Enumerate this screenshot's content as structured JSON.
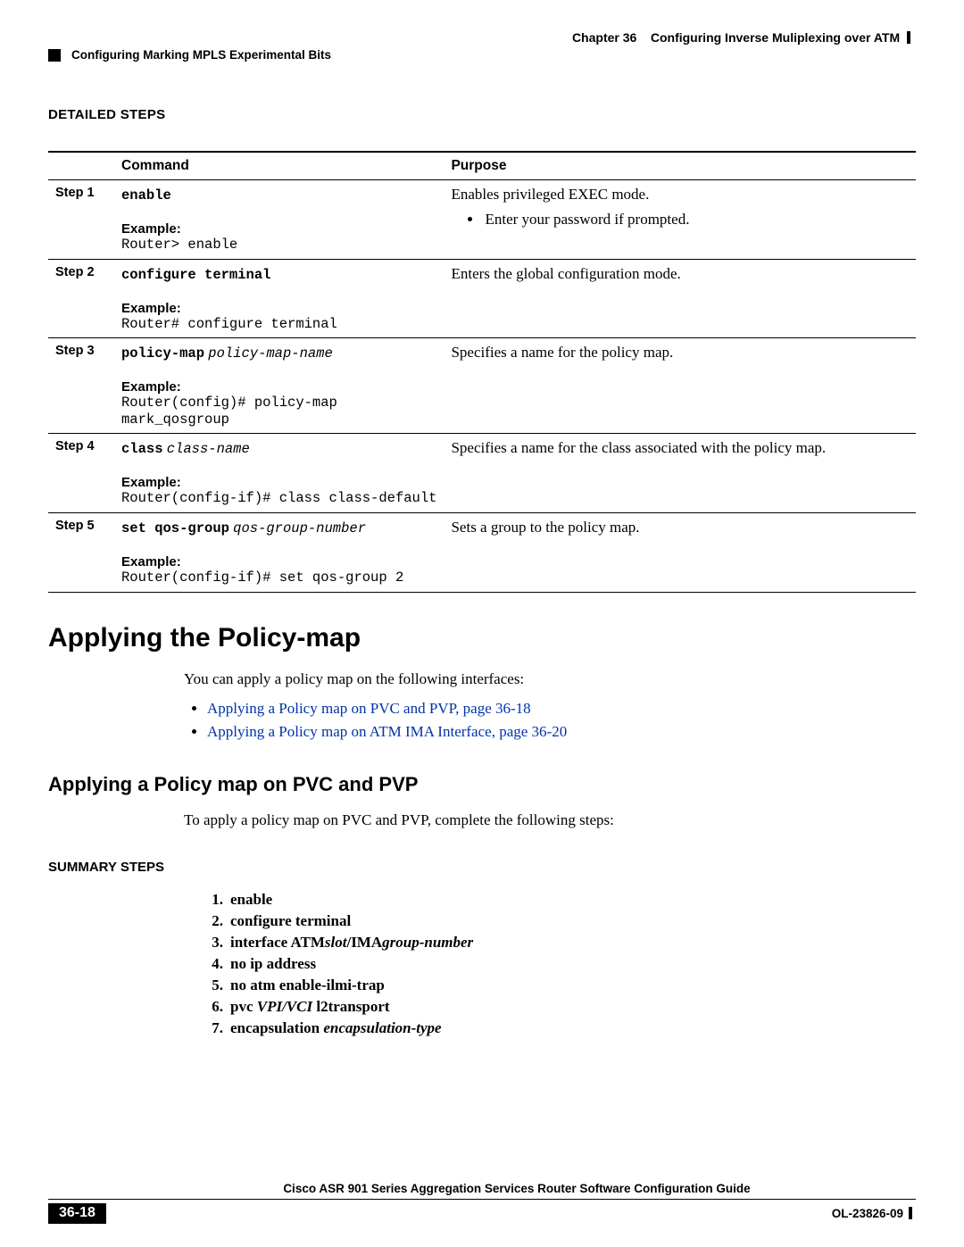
{
  "runhead": {
    "chapter_label": "Chapter 36",
    "chapter_title": "Configuring Inverse Muliplexing over ATM",
    "section_title": "Configuring Marking MPLS Experimental Bits"
  },
  "detailed_steps_heading": "DETAILED STEPS",
  "table": {
    "headers": {
      "command": "Command",
      "purpose": "Purpose"
    },
    "rows": [
      {
        "step": "Step 1",
        "cmd_bold": "enable",
        "cmd_ital": "",
        "example_label": "Example:",
        "example_code": "Router> enable",
        "purpose_text": "Enables privileged EXEC mode.",
        "purpose_bullet": "Enter your password if prompted."
      },
      {
        "step": "Step 2",
        "cmd_bold": "configure terminal",
        "cmd_ital": "",
        "example_label": "Example:",
        "example_code": "Router# configure terminal",
        "purpose_text": "Enters the global configuration mode.",
        "purpose_bullet": ""
      },
      {
        "step": "Step 3",
        "cmd_bold": "policy-map",
        "cmd_ital": "policy-map-name",
        "example_label": "Example:",
        "example_code": "Router(config)# policy-map \nmark_qosgroup",
        "purpose_text": "Specifies a name for the policy map.",
        "purpose_bullet": ""
      },
      {
        "step": "Step 4",
        "cmd_bold": "class",
        "cmd_ital": "class-name",
        "example_label": "Example:",
        "example_code": "Router(config-if)# class class-default",
        "purpose_text": "Specifies a name for the class associated with the policy map.",
        "purpose_bullet": ""
      },
      {
        "step": "Step 5",
        "cmd_bold": "set qos-group",
        "cmd_ital": "qos-group-number",
        "example_label": "Example:",
        "example_code": "Router(config-if)# set qos-group 2",
        "purpose_text": "Sets a group to the policy map.",
        "purpose_bullet": ""
      }
    ]
  },
  "h1": "Applying the Policy-map",
  "intro_text": "You can apply a policy map on the following interfaces:",
  "links": [
    "Applying a Policy map on PVC and PVP, page 36-18",
    "Applying a Policy map on ATM IMA Interface, page 36-20"
  ],
  "h2": "Applying a Policy map on PVC and PVP",
  "h2_intro": "To apply a policy map on PVC and PVP, complete the following steps:",
  "summary_heading": "SUMMARY STEPS",
  "summary": [
    {
      "n": "1.",
      "bold": "enable",
      "ital": ""
    },
    {
      "n": "2.",
      "bold": "configure terminal",
      "ital": ""
    },
    {
      "n": "3.",
      "bold": "interface ATM",
      "ital": "slot",
      "bold2": "/IMA",
      "ital2": "group-number"
    },
    {
      "n": "4.",
      "bold": "no ip address",
      "ital": ""
    },
    {
      "n": "5.",
      "bold": "no atm enable-ilmi-trap",
      "ital": ""
    },
    {
      "n": "6.",
      "bold": "pvc ",
      "ital": "VPI/VCI",
      "bold2": " l2transport",
      "ital2": ""
    },
    {
      "n": "7.",
      "bold": "encapsulation ",
      "ital": "encapsulation-type"
    }
  ],
  "footer": {
    "guide_title": "Cisco ASR 901 Series Aggregation Services Router Software Configuration Guide",
    "page": "36-18",
    "docnum": "OL-23826-09"
  }
}
